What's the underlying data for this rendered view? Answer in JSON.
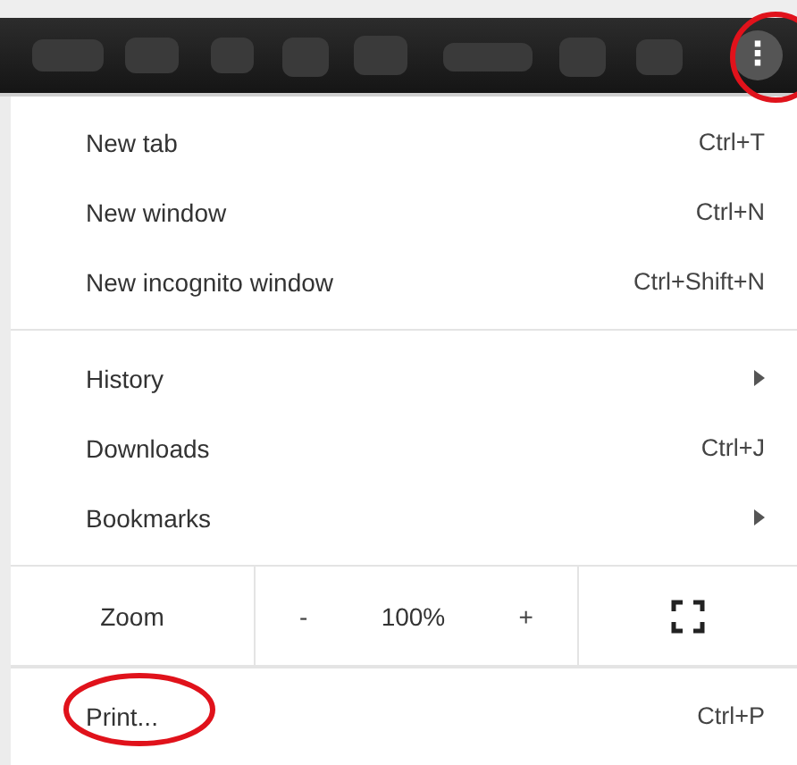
{
  "toolbar": {
    "menu_button": {
      "label": "⋮",
      "highlighted": true
    }
  },
  "menu": {
    "groups": [
      {
        "items": [
          {
            "label": "New tab",
            "kind": "shortcut",
            "shortcut": "Ctrl+T",
            "highlighted": false
          },
          {
            "label": "New window",
            "kind": "shortcut",
            "shortcut": "Ctrl+N",
            "highlighted": false
          },
          {
            "label": "New incognito window",
            "kind": "shortcut",
            "shortcut": "Ctrl+Shift+N",
            "highlighted": false
          }
        ]
      },
      {
        "items": [
          {
            "label": "History",
            "kind": "submenu",
            "highlighted": false
          },
          {
            "label": "Downloads",
            "kind": "shortcut",
            "shortcut": "Ctrl+J",
            "highlighted": false
          },
          {
            "label": "Bookmarks",
            "kind": "submenu",
            "highlighted": false
          }
        ]
      },
      {
        "items": [
          {
            "label": "Zoom",
            "kind": "zoom",
            "minus": "-",
            "value": "100%",
            "plus": "+"
          }
        ]
      },
      {
        "items": [
          {
            "label": "Print...",
            "kind": "shortcut",
            "shortcut": "Ctrl+P",
            "highlighted": true
          }
        ]
      }
    ]
  }
}
